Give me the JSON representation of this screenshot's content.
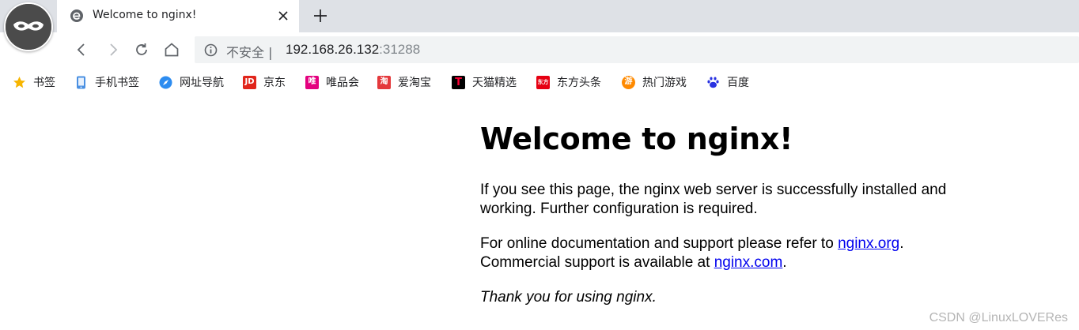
{
  "tab": {
    "title": "Welcome to nginx!",
    "favicon": "edge-e-icon"
  },
  "toolbar": {
    "security_label": "不安全 |",
    "url_host": "192.168.26.132",
    "url_port": ":31288"
  },
  "bookmarks": [
    {
      "label": "书签",
      "icon": "star-icon",
      "color": "#f7b500"
    },
    {
      "label": "手机书签",
      "icon": "phone-icon",
      "color": "#4a90e2"
    },
    {
      "label": "网址导航",
      "icon": "compass-icon",
      "color": "#2d8cf0"
    },
    {
      "label": "京东",
      "icon_text": "JD",
      "icon": "jd-icon",
      "color": "#e1251b"
    },
    {
      "label": "唯品会",
      "icon_text": "唯",
      "icon": "vip-icon",
      "color": "#e4007f"
    },
    {
      "label": "爱淘宝",
      "icon_text": "淘",
      "icon": "taobao-icon",
      "color": "#e4393c"
    },
    {
      "label": "天猫精选",
      "icon_text": "T",
      "icon": "tmall-icon",
      "color": "#000000"
    },
    {
      "label": "东方头条",
      "icon_text": "东方",
      "icon": "dftt-icon",
      "color": "#e60012"
    },
    {
      "label": "热门游戏",
      "icon_text": "游",
      "icon": "game-icon",
      "color": "#ff8a00"
    },
    {
      "label": "百度",
      "icon": "baidu-paw-icon",
      "color": "#2932e1"
    }
  ],
  "page": {
    "heading": "Welcome to nginx!",
    "p1": "If you see this page, the nginx web server is successfully installed and working. Further configuration is required.",
    "p2_prefix": "For online documentation and support please refer to ",
    "link1": "nginx.org",
    "p2_mid": ".",
    "p2_line2": "Commercial support is available at ",
    "link2": "nginx.com",
    "p2_end": ".",
    "p3": "Thank you for using nginx."
  },
  "watermark": "CSDN @LinuxLOVERes"
}
